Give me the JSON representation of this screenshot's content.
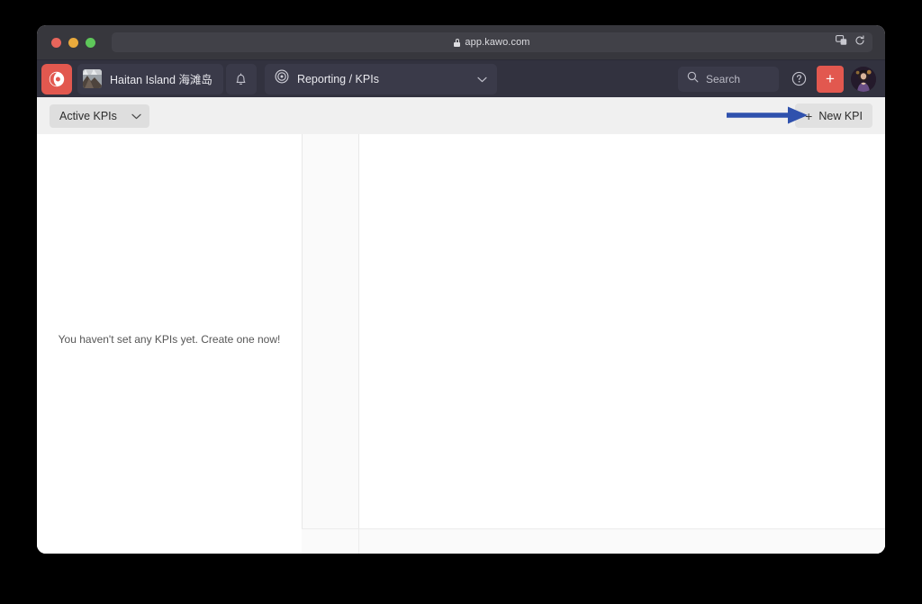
{
  "browser": {
    "url": "app.kawo.com",
    "lock_icon": "lock-icon",
    "traffic_lights": [
      "close",
      "minimize",
      "maximize"
    ],
    "right_icons": [
      "extensions-icon",
      "reload-icon"
    ]
  },
  "app_header": {
    "logo_icon": "kawo-logo-icon",
    "workspace": {
      "name": "Haitan Island 海滩岛",
      "avatar": "workspace-avatar"
    },
    "notification_icon": "bell-icon",
    "section": {
      "icon": "target-icon",
      "label": "Reporting / KPIs",
      "chevron": "chevron-down-icon"
    },
    "search": {
      "icon": "search-icon",
      "placeholder": "Search"
    },
    "help_icon": "help-circle-icon",
    "add_label": "+",
    "user_avatar": "user-avatar"
  },
  "toolbar": {
    "filter": {
      "label": "Active KPIs",
      "chevron": "chevron-down-icon"
    },
    "new_kpi": {
      "plus": "+",
      "label": "New KPI"
    },
    "annotation": {
      "type": "arrow",
      "direction": "right",
      "color": "#2f51ad",
      "points_to": "New KPI"
    }
  },
  "content": {
    "empty_state": "You haven't set any KPIs yet. Create one now!"
  },
  "colors": {
    "brand_red": "#e2584f",
    "header_dark": "#32323f",
    "chrome_dark": "#37373d",
    "toolbar_gray": "#f0f0f0",
    "annotation_blue": "#2f51ad"
  }
}
